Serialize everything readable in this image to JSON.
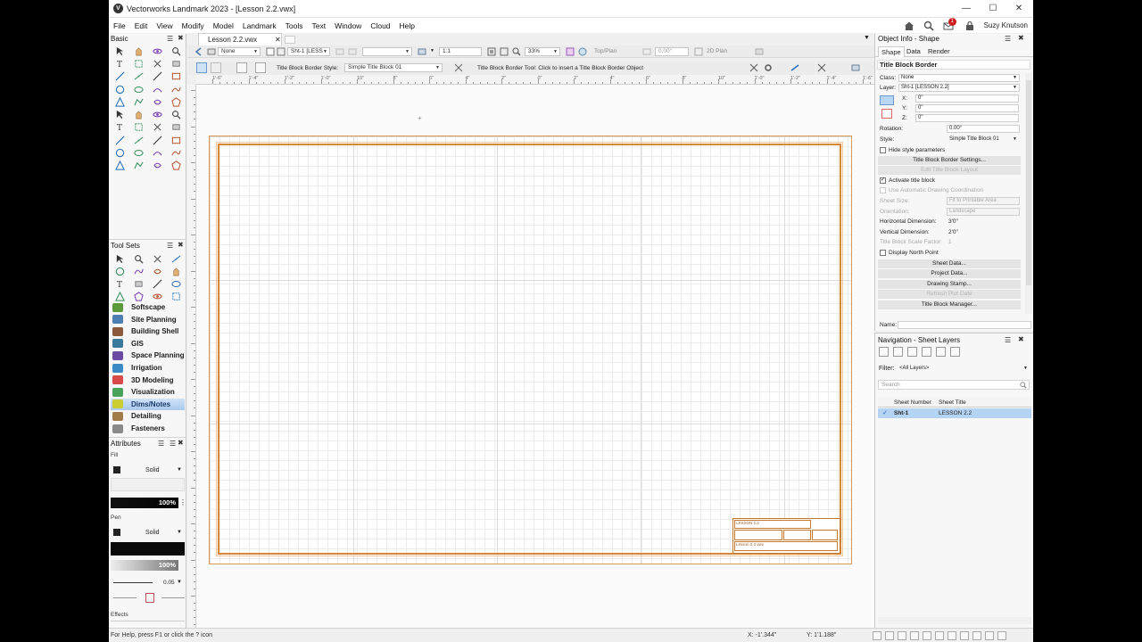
{
  "window": {
    "title": "Vectorworks Landmark 2023 - [Lesson 2.2.vwx]",
    "app_icon": "V"
  },
  "menu": [
    "File",
    "Edit",
    "View",
    "Modify",
    "Model",
    "Landmark",
    "Tools",
    "Text",
    "Window",
    "Cloud",
    "Help"
  ],
  "user": {
    "name": "Suzy Knutson",
    "notification_count": "1"
  },
  "basic_palette": {
    "title": "Basic"
  },
  "toolsets_palette": {
    "title": "Tool Sets",
    "items": [
      "Softscape",
      "Site Planning",
      "Building Shell",
      "GIS",
      "Space Planning",
      "Irrigation",
      "3D Modeling",
      "Visualization",
      "Dims/Notes",
      "Detailing",
      "Fasteners"
    ],
    "selected": "Dims/Notes"
  },
  "attributes_palette": {
    "title": "Attributes",
    "fill_label": "Fill",
    "fill_style": "Solid",
    "fill_opacity": "100%",
    "pen_label": "Pen",
    "pen_style": "Solid",
    "pen_opacity": "100%",
    "line_weight": "0.05",
    "effects_label": "Effects"
  },
  "document": {
    "tab": "Lesson 2.2.vwx"
  },
  "view_bar": {
    "class": "None",
    "layer": "Sht-1 [LESS",
    "scale": "1:1",
    "zoom": "33%",
    "view": "Top/Plan",
    "rotation": "0.00°",
    "projection": "2D Plan"
  },
  "mode_bar": {
    "style_label": "Title Block Border Style:",
    "style_value": "Simple Title Block 01",
    "hint": "Title Block Border Tool: Click to insert a Title Block Border Object"
  },
  "ruler_top": [
    "1'-6\"",
    "1'-4\"",
    "1'-2\"",
    "1'-0\"",
    "10\"",
    "8\"",
    "6\"",
    "4\"",
    "2\"",
    "0\"",
    "2\"",
    "4\"",
    "6\"",
    "8\"",
    "10\"",
    "1'-0\"",
    "1'-2\"",
    "1'-4\"",
    "1'-6\""
  ],
  "title_block": {
    "project": "LESSON 2.2",
    "file": "Lesson 2.2.vwx"
  },
  "object_info": {
    "title": "Object Info - Shape",
    "tabs": [
      "Shape",
      "Data",
      "Render"
    ],
    "object_type": "Title Block Border",
    "class_label": "Class:",
    "class_value": "None",
    "layer_label": "Layer:",
    "layer_value": "Sht-1 [LESSON 2.2]",
    "x_label": "X:",
    "x_value": "0\"",
    "y_label": "Y:",
    "y_value": "0\"",
    "z_label": "Z:",
    "z_value": "0\"",
    "rotation_label": "Rotation:",
    "rotation_value": "0.00°",
    "style_label": "Style:",
    "style_value": "Simple Title Block 01",
    "hide_style": "Hide style parameters",
    "btn_border_settings": "Title Block Border Settings...",
    "btn_edit_layout": "Edit Title Block Layout",
    "activate_title_block": "Activate title block",
    "use_auto_coord": "Use Automatic Drawing Coordination",
    "sheet_size_label": "Sheet Size:",
    "sheet_size_value": "Fit to Printable Area",
    "orientation_label": "Orientation:",
    "orientation_value": "Landscape",
    "horiz_label": "Horizontal Dimension:",
    "horiz_value": "3'0\"",
    "vert_label": "Vertical Dimension:",
    "vert_value": "2'0\"",
    "scale_factor_label": "Title Block Scale Factor:",
    "scale_factor_value": "1",
    "display_north": "Display North Point",
    "btn_sheet_data": "Sheet Data...",
    "btn_project_data": "Project Data...",
    "btn_drawing_stamp": "Drawing Stamp...",
    "btn_refresh_plot": "Refresh Plot Date",
    "btn_manager": "Title Block Manager...",
    "name_label": "Name:"
  },
  "navigation": {
    "title": "Navigation - Sheet Layers",
    "filter_label": "Filter:",
    "filter_value": "<All Layers>",
    "search_placeholder": "Search",
    "col_number": "Sheet Number",
    "col_title": "Sheet Title",
    "rows": [
      {
        "number": "Sht-1",
        "title": "LESSON 2.2"
      }
    ]
  },
  "status": {
    "help": "For Help, press F1 or click the ? icon",
    "x": "X: -1'.344\"",
    "y": "Y: 1'1.188\""
  },
  "colors": {
    "border": "#d8863a",
    "selection": "#a9c9ee",
    "accent_red": "#cc1f1f"
  }
}
